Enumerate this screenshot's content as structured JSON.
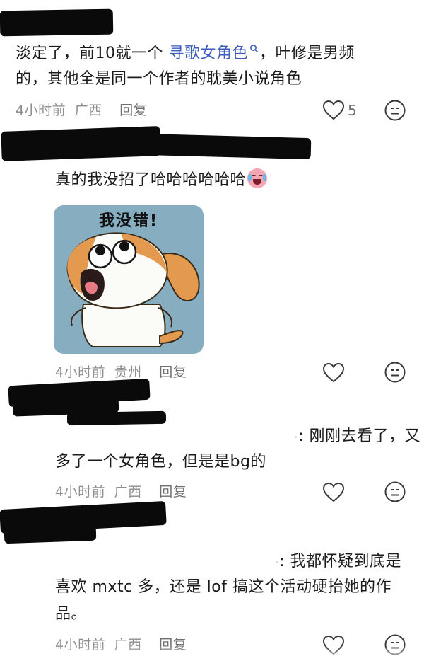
{
  "comments": [
    {
      "text_a": "淡定了，前10就一个 ",
      "link": "寻歌女角色",
      "text_b": "，叶修是男频",
      "line2": "的，其他全是同一个作者的耽美小说角色",
      "time": "4小时前",
      "location": "广西",
      "reply": "回复",
      "likes": "5"
    },
    {
      "text": "真的我没招了哈哈哈哈哈哈",
      "sticker_caption": "我没错!",
      "time": "4小时前",
      "location": "贵州",
      "reply": "回复"
    },
    {
      "line1_tail": ": 刚刚去看了，又",
      "line2": "多了一个女角色，但是是bg的",
      "time": "4小时前",
      "location": "广西",
      "reply": "回复"
    },
    {
      "line1_tail": ": 我都怀疑到底是",
      "line2": "喜欢 mxtc 多，还是 lof 搞这个活动硬抬她的作",
      "line3": "品。",
      "time": "4小时前",
      "location": "广西",
      "reply": "回复"
    }
  ]
}
